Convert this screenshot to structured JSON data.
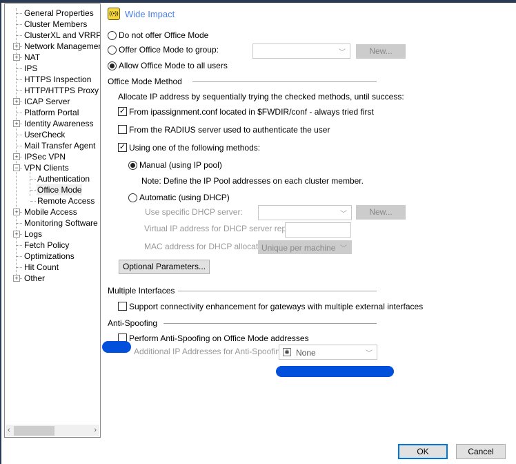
{
  "tree": {
    "items": [
      {
        "label": "General Properties",
        "level": 0,
        "expander": false
      },
      {
        "label": "Cluster Members",
        "level": 0,
        "expander": false
      },
      {
        "label": "ClusterXL and VRRP",
        "level": 0,
        "expander": false
      },
      {
        "label": "Network Management",
        "level": 0,
        "expander": "plus"
      },
      {
        "label": "NAT",
        "level": 0,
        "expander": "plus"
      },
      {
        "label": "IPS",
        "level": 0,
        "expander": false
      },
      {
        "label": "HTTPS Inspection",
        "level": 0,
        "expander": false
      },
      {
        "label": "HTTP/HTTPS Proxy",
        "level": 0,
        "expander": false
      },
      {
        "label": "ICAP Server",
        "level": 0,
        "expander": "plus"
      },
      {
        "label": "Platform Portal",
        "level": 0,
        "expander": false
      },
      {
        "label": "Identity Awareness",
        "level": 0,
        "expander": "plus"
      },
      {
        "label": "UserCheck",
        "level": 0,
        "expander": false
      },
      {
        "label": "Mail Transfer Agent",
        "level": 0,
        "expander": false
      },
      {
        "label": "IPSec VPN",
        "level": 0,
        "expander": "plus"
      },
      {
        "label": "VPN Clients",
        "level": 0,
        "expander": "minus"
      },
      {
        "label": "Authentication",
        "level": 1,
        "expander": false
      },
      {
        "label": "Office Mode",
        "level": 1,
        "expander": false,
        "selected": true
      },
      {
        "label": "Remote Access",
        "level": 1,
        "expander": false
      },
      {
        "label": "Mobile Access",
        "level": 0,
        "expander": "plus"
      },
      {
        "label": "Monitoring Software bla",
        "level": 0,
        "expander": false
      },
      {
        "label": "Logs",
        "level": 0,
        "expander": "plus"
      },
      {
        "label": "Fetch Policy",
        "level": 0,
        "expander": false
      },
      {
        "label": "Optimizations",
        "level": 0,
        "expander": false
      },
      {
        "label": "Hit Count",
        "level": 0,
        "expander": false
      },
      {
        "label": "Other",
        "level": 0,
        "expander": "plus"
      }
    ]
  },
  "header": {
    "badge": "Wide Impact",
    "icon": "broadcast-icon",
    "accent": "#4a7fe6"
  },
  "mode": {
    "none": "Do not offer Office Mode",
    "group": "Offer Office Mode to group:",
    "all": "Allow Office Mode to all users",
    "group_new": "New...",
    "selected": "all"
  },
  "method": {
    "title": "Office Mode Method",
    "desc": "Allocate IP address by sequentially trying the checked methods, until success:",
    "ipassign": "From ipassignment.conf located in $FWDIR/conf - always tried first",
    "ipassign_checked": true,
    "radius": "From the RADIUS server used to authenticate the user",
    "radius_checked": false,
    "using": "Using one of the following methods:",
    "using_checked": true,
    "manual": "Manual (using IP pool)",
    "note": "Note: Define the IP Pool addresses on each cluster member.",
    "auto": "Automatic (using DHCP)",
    "dhcp_server": "Use specific DHCP server:",
    "dhcp_new": "New...",
    "virtual_ip": "Virtual IP address for DHCP server replies:",
    "mac": "MAC address for DHCP allocation:",
    "mac_value": "Unique per machine",
    "optional": "Optional Parameters..."
  },
  "multi": {
    "title": "Multiple Interfaces",
    "support": "Support connectivity enhancement for gateways with multiple external interfaces"
  },
  "anti": {
    "title": "Anti-Spoofing",
    "perform": "Perform Anti-Spoofing on Office Mode addresses",
    "additional": "Additional IP Addresses for Anti-Spoofing:",
    "value": "None"
  },
  "footer": {
    "ok": "OK",
    "cancel": "Cancel"
  }
}
